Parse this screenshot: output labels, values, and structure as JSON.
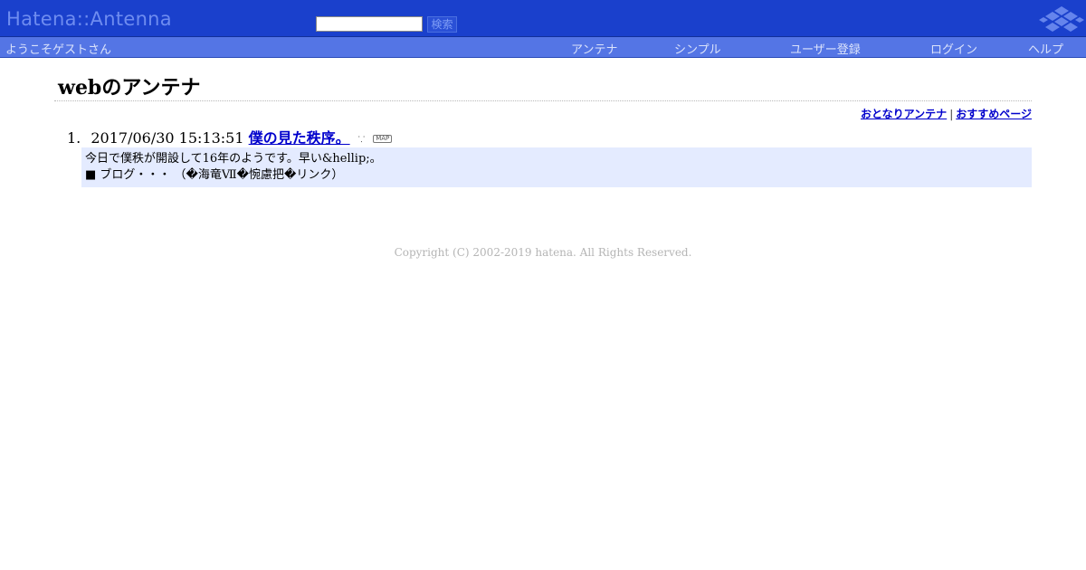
{
  "header": {
    "logo_text": "Hatena::Antenna",
    "search": {
      "value": "",
      "button_label": "検索"
    }
  },
  "subbar": {
    "welcome": "ようこそゲストさん",
    "nav": [
      "アンテナ",
      "シンプル",
      "ユーザー登録",
      "ログイン",
      "ヘルプ"
    ]
  },
  "main": {
    "title": "webのアンテナ",
    "related_links": [
      "おとなりアンテナ",
      "おすすめページ"
    ],
    "separator": "|",
    "entries": [
      {
        "number": "1.",
        "timestamp": "2017/06/30 15:13:51",
        "title": "僕の見た秩序。",
        "map_label": "MAP",
        "snippet_line1": "今日で僕秩が開設して16年のようです。早い&hellip;。",
        "snippet_line2": "■ ブログ・・・ （�海竜Ⅶ�惋慮把�リンク）"
      }
    ]
  },
  "footer": {
    "copyright": "Copyright (C) 2002-2019 hatena. All Rights Reserved."
  },
  "colors": {
    "header_bg": "#1a40cc",
    "subbar_bg": "#5475e5",
    "link": "#0000cc",
    "snippet_bg": "#e4ebff"
  }
}
